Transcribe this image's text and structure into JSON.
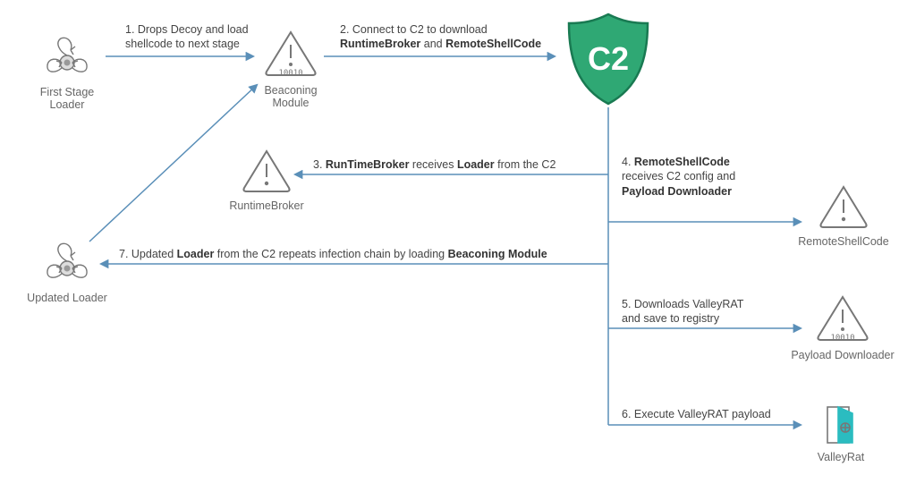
{
  "nodes": {
    "first_stage_loader": "First Stage Loader",
    "beaconing_module": "Beaconing Module",
    "c2": "C2",
    "runtime_broker": "RuntimeBroker",
    "remote_shellcode": "RemoteShellCode",
    "updated_loader": "Updated Loader",
    "payload_downloader": "Payload Downloader",
    "valleyrat": "ValleyRat"
  },
  "steps": {
    "s1_a": "1. Drops Decoy and load",
    "s1_b": "shellcode to next stage",
    "s2_a": "2. Connect to C2 to download",
    "s2_b1": "RuntimeBroker",
    "s2_b2": " and ",
    "s2_b3": "RemoteShellCode",
    "s3_a": "3. ",
    "s3_b": "RunTimeBroker",
    "s3_c": " receives ",
    "s3_d": "Loader",
    "s3_e": " from the C2",
    "s4_a": "4. ",
    "s4_b": "RemoteShellCode",
    "s4_c": "receives C2 config and",
    "s4_d": "Payload Downloader",
    "s5_a": "5. Downloads ValleyRAT",
    "s5_b": "and save to registry",
    "s6": "6. Execute  ValleyRAT payload",
    "s7_a": "7. Updated ",
    "s7_b": "Loader",
    "s7_c": " from the C2 repeats infection chain by loading ",
    "s7_d": "Beaconing Module"
  }
}
